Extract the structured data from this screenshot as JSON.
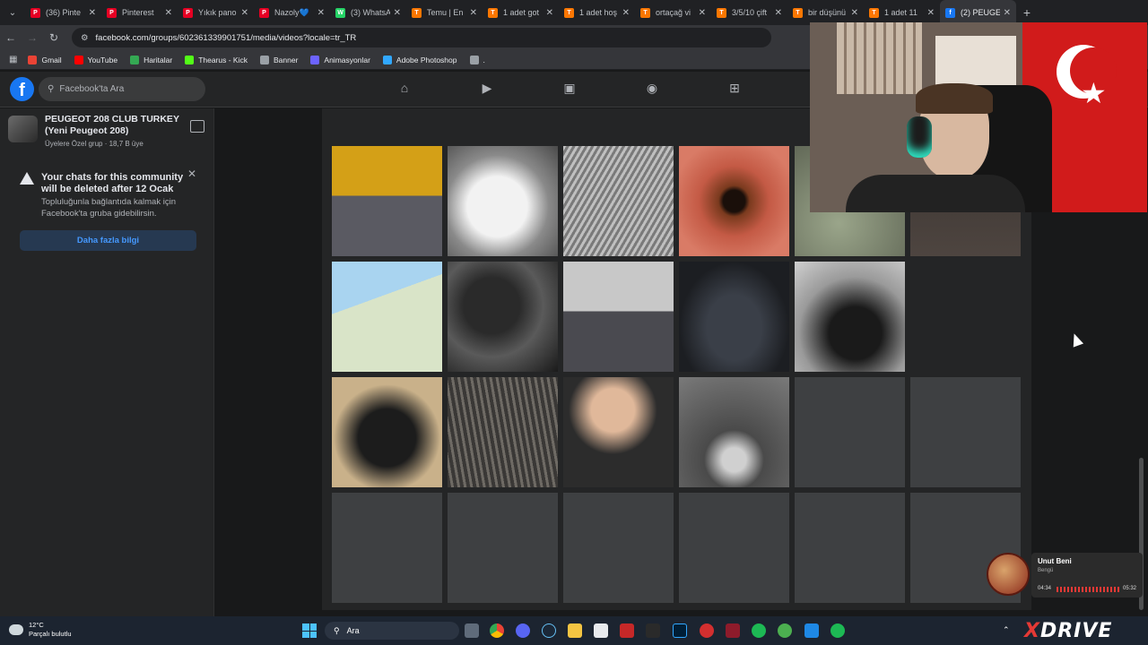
{
  "browser": {
    "tabs": [
      {
        "label": "(36) Pinte",
        "color": "#e60023",
        "glyph": "P",
        "active": false
      },
      {
        "label": "Pinterest",
        "color": "#e60023",
        "glyph": "P",
        "active": false
      },
      {
        "label": "Yıkık pano",
        "color": "#e60023",
        "glyph": "P",
        "active": false
      },
      {
        "label": "Nazoly💙",
        "color": "#e60023",
        "glyph": "P",
        "active": false
      },
      {
        "label": "(3) WhatsA",
        "color": "#25d366",
        "glyph": "W",
        "active": false
      },
      {
        "label": "Temu | En",
        "color": "#fb7701",
        "glyph": "T",
        "active": false
      },
      {
        "label": "1 adet got",
        "color": "#fb7701",
        "glyph": "T",
        "active": false
      },
      {
        "label": "1 adet hoş",
        "color": "#fb7701",
        "glyph": "T",
        "active": false
      },
      {
        "label": "ortaçağ vi",
        "color": "#fb7701",
        "glyph": "T",
        "active": false
      },
      {
        "label": "3/5/10 çift",
        "color": "#fb7701",
        "glyph": "T",
        "active": false
      },
      {
        "label": "bir düşünü",
        "color": "#fb7701",
        "glyph": "T",
        "active": false
      },
      {
        "label": "1 adet 11",
        "color": "#fb7701",
        "glyph": "T",
        "active": false
      },
      {
        "label": "(2) PEUGE",
        "color": "#1877f2",
        "glyph": "f",
        "active": true
      }
    ],
    "url": "facebook.com/groups/602361339901751/media/videos?locale=tr_TR",
    "bookmarks": [
      {
        "label": "Gmail",
        "color": "#ea4335"
      },
      {
        "label": "YouTube",
        "color": "#ff0000"
      },
      {
        "label": "Haritalar",
        "color": "#34a853"
      },
      {
        "label": "Thearus - Kick",
        "color": "#53fc18"
      },
      {
        "label": "Banner",
        "color": "#9aa0a6"
      },
      {
        "label": "Animasyonlar",
        "color": "#6c63ff"
      },
      {
        "label": "Adobe Photoshop",
        "color": "#31a8ff"
      },
      {
        "label": ".",
        "color": "#9aa0a6"
      }
    ]
  },
  "facebook": {
    "logo": "f",
    "search_placeholder": "Facebook'ta Ara",
    "group": {
      "name": "PEUGEOT 208 CLUB TURKEY (Yeni Peugeot 208)",
      "meta": "Üyelere Özel grup · 18,7 B üye"
    },
    "notice": {
      "title": "Your chats for this community will be deleted after 12 Ocak",
      "body": "Topluluğunla bağlantıda kalmak için Facebook'ta gruba gidebilirsin.",
      "button": "Daha fazla bilgi"
    }
  },
  "spotify": {
    "title": "Unut Beni",
    "artist": "Bengü",
    "elapsed": "04:34",
    "duration": "05:32"
  },
  "taskbar": {
    "temperature": "12°C",
    "weather": "Parçalı bulutlu",
    "search_label": "Ara"
  },
  "overlay_brand": {
    "prefix": "X",
    "rest": "DRIVE"
  },
  "colors": {
    "accent": "#1877f2",
    "bg": "#18191a",
    "panel": "#242526"
  }
}
